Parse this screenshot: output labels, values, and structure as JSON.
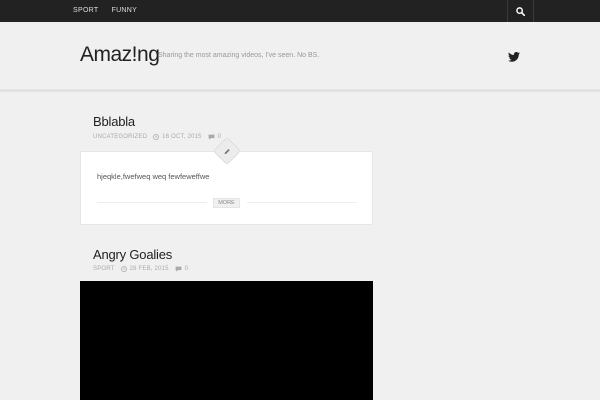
{
  "topbar": {
    "nav": [
      {
        "label": "SPORT"
      },
      {
        "label": "FUNNY"
      }
    ],
    "search_icon": "search-icon"
  },
  "header": {
    "logo": "Amaz!ng",
    "tagline": "Sharing the most amazing videos, I've seen. No BS.",
    "social_icon": "twitter-icon"
  },
  "posts": [
    {
      "title": "Bblabla",
      "category": "UNCATEGORIZED",
      "date": "16 OCT, 2015",
      "comments": "0",
      "format_icon": "pencil-icon",
      "excerpt": "hjeqkle,fwefweq weq fewfeweffwe",
      "more_label": "MORE"
    },
    {
      "title": "Angry Goalies",
      "category": "SPORT",
      "date": "28 FEB, 2015",
      "comments": "0"
    }
  ],
  "colors": {
    "topbar": "#222222",
    "background": "#f0f0f0",
    "video": "#000000"
  }
}
